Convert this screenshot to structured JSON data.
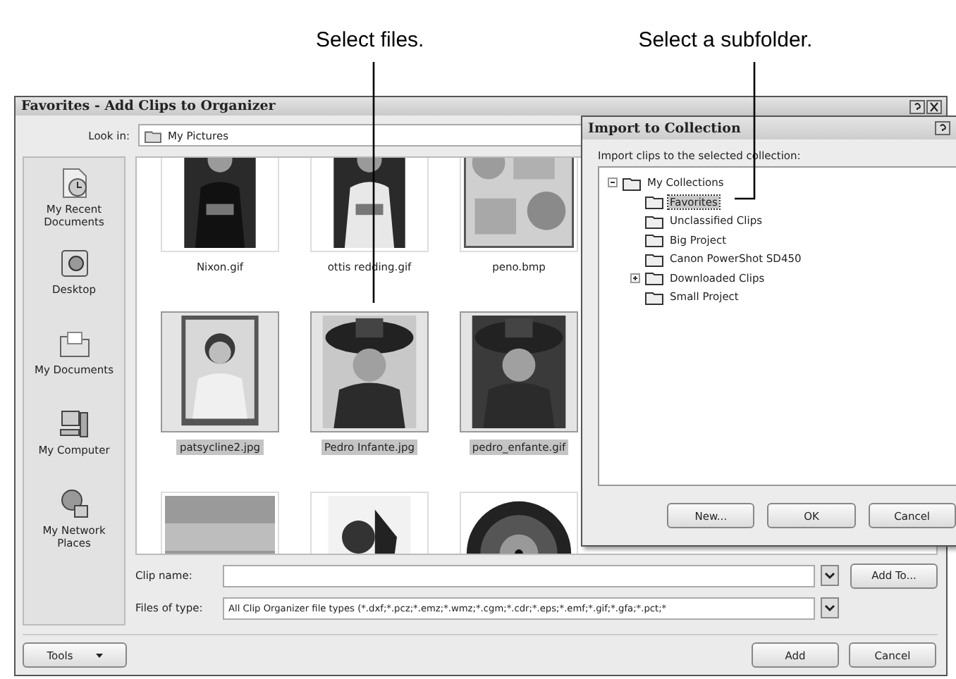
{
  "callouts": [
    {
      "text": "Select files."
    },
    {
      "text": "Select a subfolder."
    }
  ],
  "main_dialog": {
    "title": "Favorites - Add Clips to Organizer",
    "look_in": {
      "label": "Look in:",
      "value": "My Pictures"
    },
    "places": [
      {
        "label": "My Recent Documents"
      },
      {
        "label": "Desktop"
      },
      {
        "label": "My Documents"
      },
      {
        "label": "My Computer"
      },
      {
        "label": "My Network Places"
      }
    ],
    "files": [
      {
        "kind": "picture",
        "name": "Nixon.gif",
        "selected": false
      },
      {
        "kind": "picture",
        "name": "ottis redding.gif",
        "selected": false
      },
      {
        "kind": "picture",
        "name": "peno.bmp",
        "selected": false
      },
      {
        "kind": "picture",
        "name": "patsycline2.jpg",
        "selected": true
      },
      {
        "kind": "picture",
        "name": "Pedro Infante.jpg",
        "selected": true
      },
      {
        "kind": "picture",
        "name": "pedro_enfante.gif",
        "selected": true
      },
      {
        "kind": "picture",
        "selected": false
      },
      {
        "kind": "picture",
        "selected": false
      },
      {
        "kind": "picture",
        "selected": false
      }
    ],
    "clip_name": {
      "label": "Clip name:"
    },
    "files_of_type": {
      "label": "Files of type:",
      "value": "All Clip Organizer file types (*.dxf;*.pcz;*.emz;*.wmz;*.cgm;*.cdr;*.eps;*.emf;*.gif;*.gfa;*.pct;*"
    },
    "buttons": {
      "add_to": "Add To...",
      "tools": "Tools",
      "add": "Add",
      "cancel": "Cancel"
    }
  },
  "import_dialog": {
    "title": "Import to Collection",
    "prompt": "Import clips to the selected collection:",
    "tree": [
      {
        "label": "My Collections",
        "expanded": true,
        "selected": false,
        "children": [
          {
            "label": "Favorites",
            "selected": true
          },
          {
            "label": "Unclassified Clips",
            "selected": false
          },
          {
            "label": "Big Project",
            "selected": false
          },
          {
            "label": "Canon PowerShot SD450",
            "selected": false
          },
          {
            "label": "Downloaded Clips",
            "expanded": false,
            "selected": false
          },
          {
            "label": "Small Project",
            "selected": false
          }
        ]
      }
    ],
    "buttons": [
      "New...",
      "OK",
      "Cancel"
    ]
  }
}
